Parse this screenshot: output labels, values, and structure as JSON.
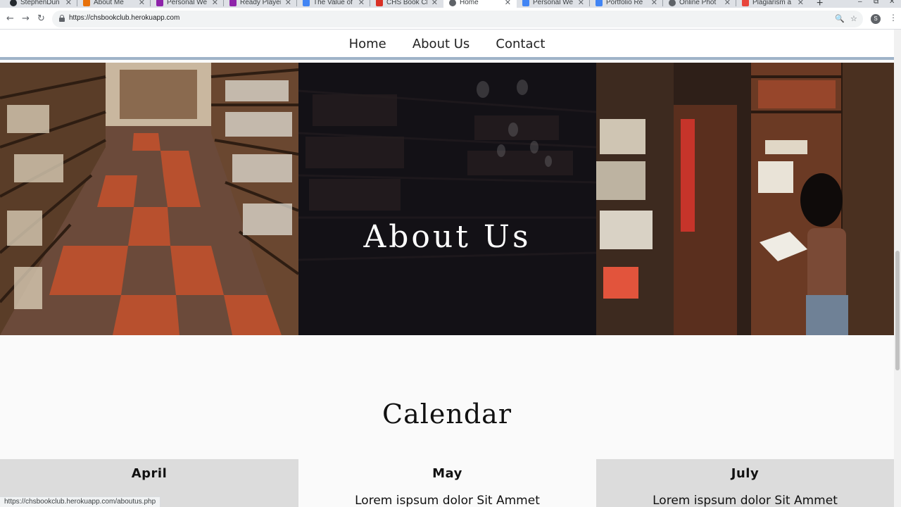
{
  "browser": {
    "tabs": [
      {
        "label": "StephenDun",
        "icon": "github-icon",
        "color": "#24292e"
      },
      {
        "label": "About Me",
        "icon": "site-icon",
        "color": "#e8710a"
      },
      {
        "label": "Personal We",
        "icon": "site-icon",
        "color": "#8e24aa"
      },
      {
        "label": "Ready Player",
        "icon": "site-icon",
        "color": "#8e24aa"
      },
      {
        "label": "The Value of",
        "icon": "docs-icon",
        "color": "#4285f4"
      },
      {
        "label": "CHS Book Cl",
        "icon": "gmail-icon",
        "color": "#d93025"
      },
      {
        "label": "Home",
        "icon": "globe-icon",
        "color": "#5f6368"
      },
      {
        "label": "Personal We",
        "icon": "docs-icon",
        "color": "#4285f4"
      },
      {
        "label": "Portfolio Re",
        "icon": "docs-icon",
        "color": "#4285f4"
      },
      {
        "label": "Online Phot",
        "icon": "globe-icon",
        "color": "#5f6368"
      },
      {
        "label": "Plagiarism a",
        "icon": "site-icon",
        "color": "#e8453c"
      }
    ],
    "new_tab": "+",
    "controls": {
      "minimize": "–",
      "restore": "⧉",
      "close": "✕"
    },
    "back": "←",
    "forward": "→",
    "reload": "↻",
    "url": "https://chsbookclub.herokuapp.com",
    "zoom_icon": "🔍",
    "star_icon": "☆",
    "profile_initial": "S",
    "menu": "⋮"
  },
  "site": {
    "nav": [
      "Home",
      "About Us",
      "Contact"
    ],
    "hero_title": "About Us",
    "section_title": "Calendar",
    "months": [
      {
        "name": "April",
        "text": ""
      },
      {
        "name": "May",
        "text": "Lorem ispsum dolor Sit Ammet"
      },
      {
        "name": "July",
        "text": "Lorem ispsum dolor Sit Ammet"
      }
    ]
  },
  "status_url": "https://chsbookclub.herokuapp.com/aboutus.php"
}
